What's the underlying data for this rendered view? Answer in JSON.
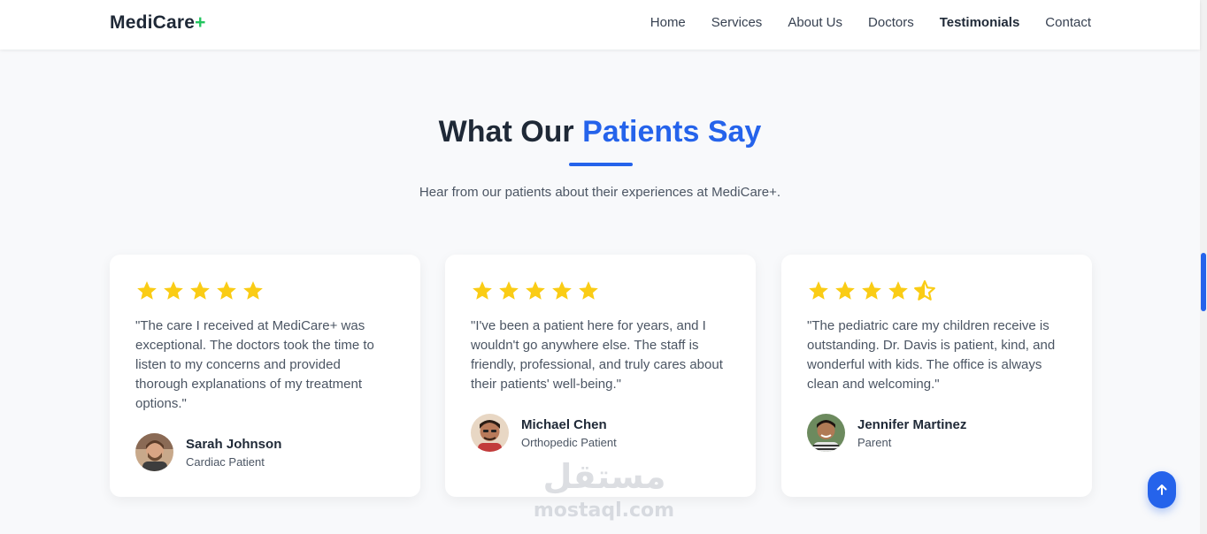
{
  "header": {
    "logo_text": "MediCare",
    "logo_plus": "+",
    "nav": [
      {
        "label": "Home"
      },
      {
        "label": "Services"
      },
      {
        "label": "About Us"
      },
      {
        "label": "Doctors"
      },
      {
        "label": "Testimonials",
        "active": true
      },
      {
        "label": "Contact"
      }
    ]
  },
  "section": {
    "title_prefix": "What Our ",
    "title_accent": "Patients Say",
    "subtitle": "Hear from our patients about their experiences at MediCare+."
  },
  "testimonials": [
    {
      "rating": 5,
      "quote": "\"The care I received at MediCare+ was exceptional. The doctors took the time to listen to my concerns and provided thorough explanations of my treatment options.\"",
      "name": "Sarah Johnson",
      "role": "Cardiac Patient"
    },
    {
      "rating": 5,
      "quote": "\"I've been a patient here for years, and I wouldn't go anywhere else. The staff is friendly, professional, and truly cares about their patients' well-being.\"",
      "name": "Michael Chen",
      "role": "Orthopedic Patient"
    },
    {
      "rating": 4.5,
      "quote": "\"The pediatric care my children receive is outstanding. Dr. Davis is patient, kind, and wonderful with kids. The office is always clean and welcoming.\"",
      "name": "Jennifer Martinez",
      "role": "Parent"
    }
  ],
  "watermark": {
    "arabic": "مستقل",
    "latin": "mostaql.com"
  },
  "colors": {
    "accent": "#2563eb",
    "logo_plus": "#22c55e",
    "star": "#facc15",
    "background": "#f8f9fb"
  },
  "icons": {
    "star": "star-icon",
    "half_star": "half-star-icon",
    "back_to_top": "arrow-up-icon"
  }
}
